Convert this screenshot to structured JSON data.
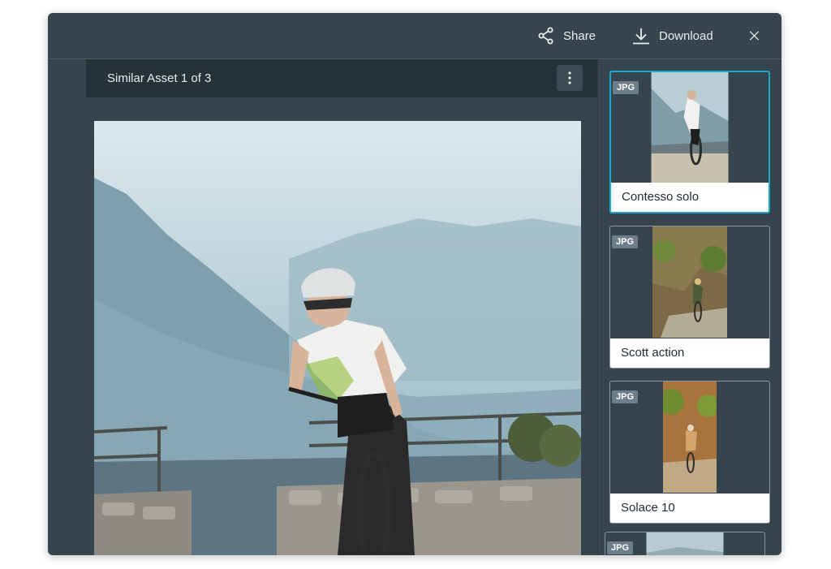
{
  "toolbar": {
    "share_label": "Share",
    "download_label": "Download",
    "close_icon": "close-icon"
  },
  "viewer": {
    "title": "Similar Asset 1 of 3",
    "menu_icon": "kebab-menu-icon"
  },
  "similar_assets": [
    {
      "badge": "JPG",
      "caption": "Contesso solo",
      "selected": true
    },
    {
      "badge": "JPG",
      "caption": "Scott action",
      "selected": false
    },
    {
      "badge": "JPG",
      "caption": "Solace 10",
      "selected": false
    },
    {
      "badge": "JPG",
      "caption": "",
      "selected": false
    }
  ],
  "colors": {
    "modal_bg": "#36444d",
    "header_bg": "#26323a",
    "selected_border": "#1aa7cc",
    "badge_bg": "#6c7e89"
  }
}
